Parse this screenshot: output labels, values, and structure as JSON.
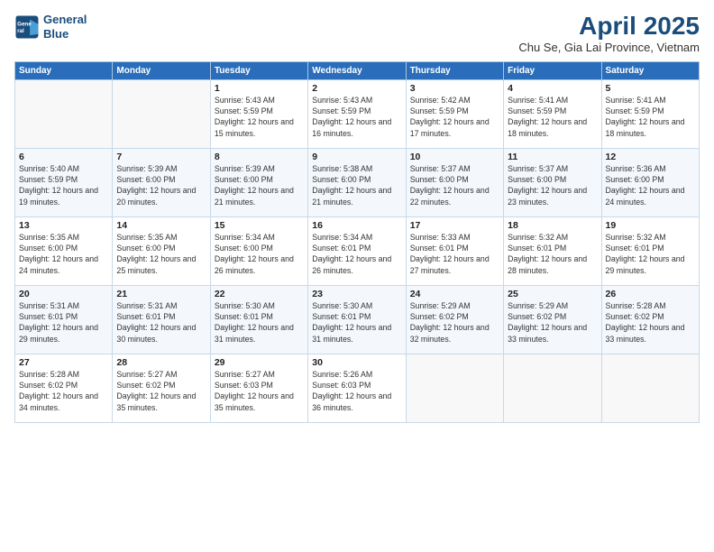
{
  "logo": {
    "line1": "General",
    "line2": "Blue"
  },
  "title": "April 2025",
  "subtitle": "Chu Se, Gia Lai Province, Vietnam",
  "weekdays": [
    "Sunday",
    "Monday",
    "Tuesday",
    "Wednesday",
    "Thursday",
    "Friday",
    "Saturday"
  ],
  "weeks": [
    [
      {
        "day": "",
        "info": ""
      },
      {
        "day": "",
        "info": ""
      },
      {
        "day": "1",
        "info": "Sunrise: 5:43 AM\nSunset: 5:59 PM\nDaylight: 12 hours and 15 minutes."
      },
      {
        "day": "2",
        "info": "Sunrise: 5:43 AM\nSunset: 5:59 PM\nDaylight: 12 hours and 16 minutes."
      },
      {
        "day": "3",
        "info": "Sunrise: 5:42 AM\nSunset: 5:59 PM\nDaylight: 12 hours and 17 minutes."
      },
      {
        "day": "4",
        "info": "Sunrise: 5:41 AM\nSunset: 5:59 PM\nDaylight: 12 hours and 18 minutes."
      },
      {
        "day": "5",
        "info": "Sunrise: 5:41 AM\nSunset: 5:59 PM\nDaylight: 12 hours and 18 minutes."
      }
    ],
    [
      {
        "day": "6",
        "info": "Sunrise: 5:40 AM\nSunset: 5:59 PM\nDaylight: 12 hours and 19 minutes."
      },
      {
        "day": "7",
        "info": "Sunrise: 5:39 AM\nSunset: 6:00 PM\nDaylight: 12 hours and 20 minutes."
      },
      {
        "day": "8",
        "info": "Sunrise: 5:39 AM\nSunset: 6:00 PM\nDaylight: 12 hours and 21 minutes."
      },
      {
        "day": "9",
        "info": "Sunrise: 5:38 AM\nSunset: 6:00 PM\nDaylight: 12 hours and 21 minutes."
      },
      {
        "day": "10",
        "info": "Sunrise: 5:37 AM\nSunset: 6:00 PM\nDaylight: 12 hours and 22 minutes."
      },
      {
        "day": "11",
        "info": "Sunrise: 5:37 AM\nSunset: 6:00 PM\nDaylight: 12 hours and 23 minutes."
      },
      {
        "day": "12",
        "info": "Sunrise: 5:36 AM\nSunset: 6:00 PM\nDaylight: 12 hours and 24 minutes."
      }
    ],
    [
      {
        "day": "13",
        "info": "Sunrise: 5:35 AM\nSunset: 6:00 PM\nDaylight: 12 hours and 24 minutes."
      },
      {
        "day": "14",
        "info": "Sunrise: 5:35 AM\nSunset: 6:00 PM\nDaylight: 12 hours and 25 minutes."
      },
      {
        "day": "15",
        "info": "Sunrise: 5:34 AM\nSunset: 6:00 PM\nDaylight: 12 hours and 26 minutes."
      },
      {
        "day": "16",
        "info": "Sunrise: 5:34 AM\nSunset: 6:01 PM\nDaylight: 12 hours and 26 minutes."
      },
      {
        "day": "17",
        "info": "Sunrise: 5:33 AM\nSunset: 6:01 PM\nDaylight: 12 hours and 27 minutes."
      },
      {
        "day": "18",
        "info": "Sunrise: 5:32 AM\nSunset: 6:01 PM\nDaylight: 12 hours and 28 minutes."
      },
      {
        "day": "19",
        "info": "Sunrise: 5:32 AM\nSunset: 6:01 PM\nDaylight: 12 hours and 29 minutes."
      }
    ],
    [
      {
        "day": "20",
        "info": "Sunrise: 5:31 AM\nSunset: 6:01 PM\nDaylight: 12 hours and 29 minutes."
      },
      {
        "day": "21",
        "info": "Sunrise: 5:31 AM\nSunset: 6:01 PM\nDaylight: 12 hours and 30 minutes."
      },
      {
        "day": "22",
        "info": "Sunrise: 5:30 AM\nSunset: 6:01 PM\nDaylight: 12 hours and 31 minutes."
      },
      {
        "day": "23",
        "info": "Sunrise: 5:30 AM\nSunset: 6:01 PM\nDaylight: 12 hours and 31 minutes."
      },
      {
        "day": "24",
        "info": "Sunrise: 5:29 AM\nSunset: 6:02 PM\nDaylight: 12 hours and 32 minutes."
      },
      {
        "day": "25",
        "info": "Sunrise: 5:29 AM\nSunset: 6:02 PM\nDaylight: 12 hours and 33 minutes."
      },
      {
        "day": "26",
        "info": "Sunrise: 5:28 AM\nSunset: 6:02 PM\nDaylight: 12 hours and 33 minutes."
      }
    ],
    [
      {
        "day": "27",
        "info": "Sunrise: 5:28 AM\nSunset: 6:02 PM\nDaylight: 12 hours and 34 minutes."
      },
      {
        "day": "28",
        "info": "Sunrise: 5:27 AM\nSunset: 6:02 PM\nDaylight: 12 hours and 35 minutes."
      },
      {
        "day": "29",
        "info": "Sunrise: 5:27 AM\nSunset: 6:03 PM\nDaylight: 12 hours and 35 minutes."
      },
      {
        "day": "30",
        "info": "Sunrise: 5:26 AM\nSunset: 6:03 PM\nDaylight: 12 hours and 36 minutes."
      },
      {
        "day": "",
        "info": ""
      },
      {
        "day": "",
        "info": ""
      },
      {
        "day": "",
        "info": ""
      }
    ]
  ]
}
